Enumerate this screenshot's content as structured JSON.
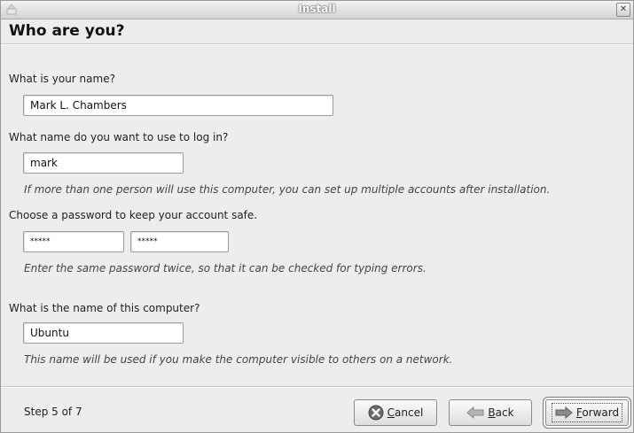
{
  "window": {
    "title": "Install"
  },
  "page": {
    "title": "Who are you?"
  },
  "name_section": {
    "label": "What is your name?",
    "value": "Mark L. Chambers"
  },
  "login_section": {
    "label": "What name do you want to use to log in?",
    "value": "mark",
    "hint": "If more than one person will use this computer, you can set up multiple accounts after installation."
  },
  "password_section": {
    "label": "Choose a password to keep your account safe.",
    "password_value": "*****",
    "confirm_value": "*****",
    "hint": "Enter the same password twice, so that it can be checked for typing errors."
  },
  "computer_section": {
    "label": "What is the name of this computer?",
    "value": "Ubuntu",
    "hint": "This name will be used if you make the computer visible to others on a network."
  },
  "footer": {
    "step": "Step 5 of 7",
    "cancel": {
      "accel": "C",
      "rest": "ancel",
      "icon": "cancel-icon"
    },
    "back": {
      "accel": "B",
      "rest": "ack",
      "icon": "back-arrow-icon"
    },
    "forward": {
      "accel": "F",
      "rest": "orward",
      "icon": "forward-arrow-icon"
    }
  }
}
